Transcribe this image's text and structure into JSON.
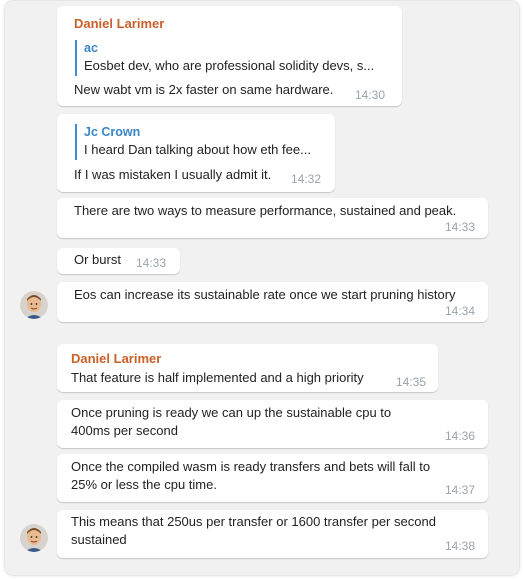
{
  "messages": [
    {
      "sender": "Daniel Larimer",
      "reply": {
        "name": "ac",
        "text": "Eosbet dev, who are professional solidity devs, s..."
      },
      "text": "New wabt vm is 2x faster on same hardware.",
      "time": "14:30"
    },
    {
      "reply": {
        "name": "Jc Crown",
        "text": "I heard Dan talking about how eth fee..."
      },
      "text": "If I was mistaken I usually admit it.",
      "time": "14:32"
    },
    {
      "text": "There are two ways to measure performance, sustained and peak.",
      "time": "14:33"
    },
    {
      "text": "Or burst",
      "time": "14:33"
    },
    {
      "text": "Eos can increase its sustainable rate once we start pruning history",
      "time": "14:34"
    },
    {
      "sender": "Daniel Larimer",
      "text": "That feature is half implemented and a high priority",
      "time": "14:35"
    },
    {
      "text": "Once pruning is ready we can up the sustainable cpu to 400ms per second",
      "time": "14:36"
    },
    {
      "text": "Once the compiled wasm is ready transfers and bets will fall to 25% or less the cpu time.",
      "time": "14:37"
    },
    {
      "text": "This means that 250us per transfer or 1600 transfer per second sustained",
      "time": "14:38"
    }
  ]
}
